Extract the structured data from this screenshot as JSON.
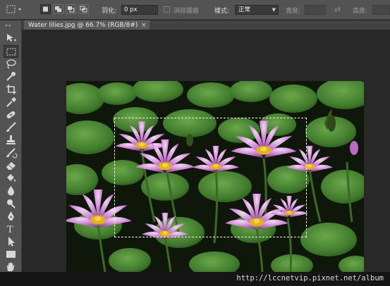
{
  "options_bar": {
    "feather_label": "羽化:",
    "feather_value": "0 px",
    "antialias_label": "消除鋸齒",
    "style_label": "樣式:",
    "style_value": "正常",
    "width_label": "寬度:",
    "height_label": "高度:"
  },
  "document_tab": {
    "title": "Water lilies.jpg @ 66.7% (RGB/8#)",
    "close_glyph": "×"
  },
  "tools": [
    "move-tool",
    "rectangular-marquee-tool",
    "lasso-tool",
    "quick-selection-tool",
    "crop-tool",
    "eyedropper-tool",
    "spot-healing-brush-tool",
    "brush-tool",
    "clone-stamp-tool",
    "history-brush-tool",
    "eraser-tool",
    "paint-bucket-tool",
    "blur-tool",
    "dodge-tool",
    "pen-tool",
    "horizontal-type-tool",
    "path-selection-tool",
    "rectangle-tool",
    "hand-tool"
  ],
  "active_tool": "rectangular-marquee-tool",
  "watermark": "http://lccnetvip.pixnet.net/album",
  "colors": {
    "app_chrome": "#535353",
    "workspace": "#282828",
    "lily_petal": "#c77ad0",
    "lily_center": "#e2b21a",
    "lily_pad": "#3f7a2c"
  }
}
